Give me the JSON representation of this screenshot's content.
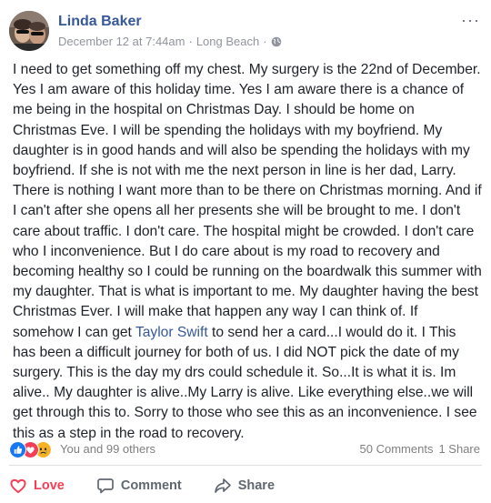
{
  "post": {
    "author": "Linda Baker",
    "date": "December 12 at 7:44am",
    "separator": "·",
    "location": "Long Beach",
    "separator2": "·",
    "more_label": "···",
    "text_before_link": "I need to get something off my chest. My surgery is the 22nd of December. Yes I am aware of this holiday time. Yes I am aware there is a chance of me being in the hospital on Christmas Day. I should be home on Christmas Eve. I will be spending the holidays with my boyfriend. My daughter is in good hands and will also be spending the holidays with my boyfriend. If she is not with me the next person in line is her dad, Larry. There is nothing I want more than to be there on Christmas morning. And if I can't after she opens all her presents she will be brought to me. I don't care about traffic. I don't care. The hospital might be crowded. I don't care who I inconvenience. But I do care about is my road to recovery and becoming healthy so I could be running on the boardwalk this summer with my daughter. That is what is important to me. My daughter having the best Christmas Ever. I will make that happen any way I can think of. If somehow I can get ",
    "link_text": "Taylor Swift",
    "text_after_link": " to send her a card...I would do it. I This has been a difficult journey for both of us. I did NOT pick the date of my surgery. This is the day my drs could schedule it. So...It is what it is. Im alive.. My daughter is alive..My Larry is alive. Like everything else..we will get through this to. Sorry to those who see this as an inconvenience. I see this as a step in the road to recovery."
  },
  "reactions": {
    "icons": [
      "like-icon",
      "love-icon",
      "sad-icon"
    ],
    "summary": "You and 99 others",
    "comments": "50 Comments",
    "shares": "1 Share"
  },
  "actions": {
    "love_label": "Love",
    "comment_label": "Comment",
    "share_label": "Share"
  },
  "colors": {
    "link": "#365899",
    "love": "#f33e58",
    "like": "#1877f2",
    "sad": "#f7b125"
  }
}
